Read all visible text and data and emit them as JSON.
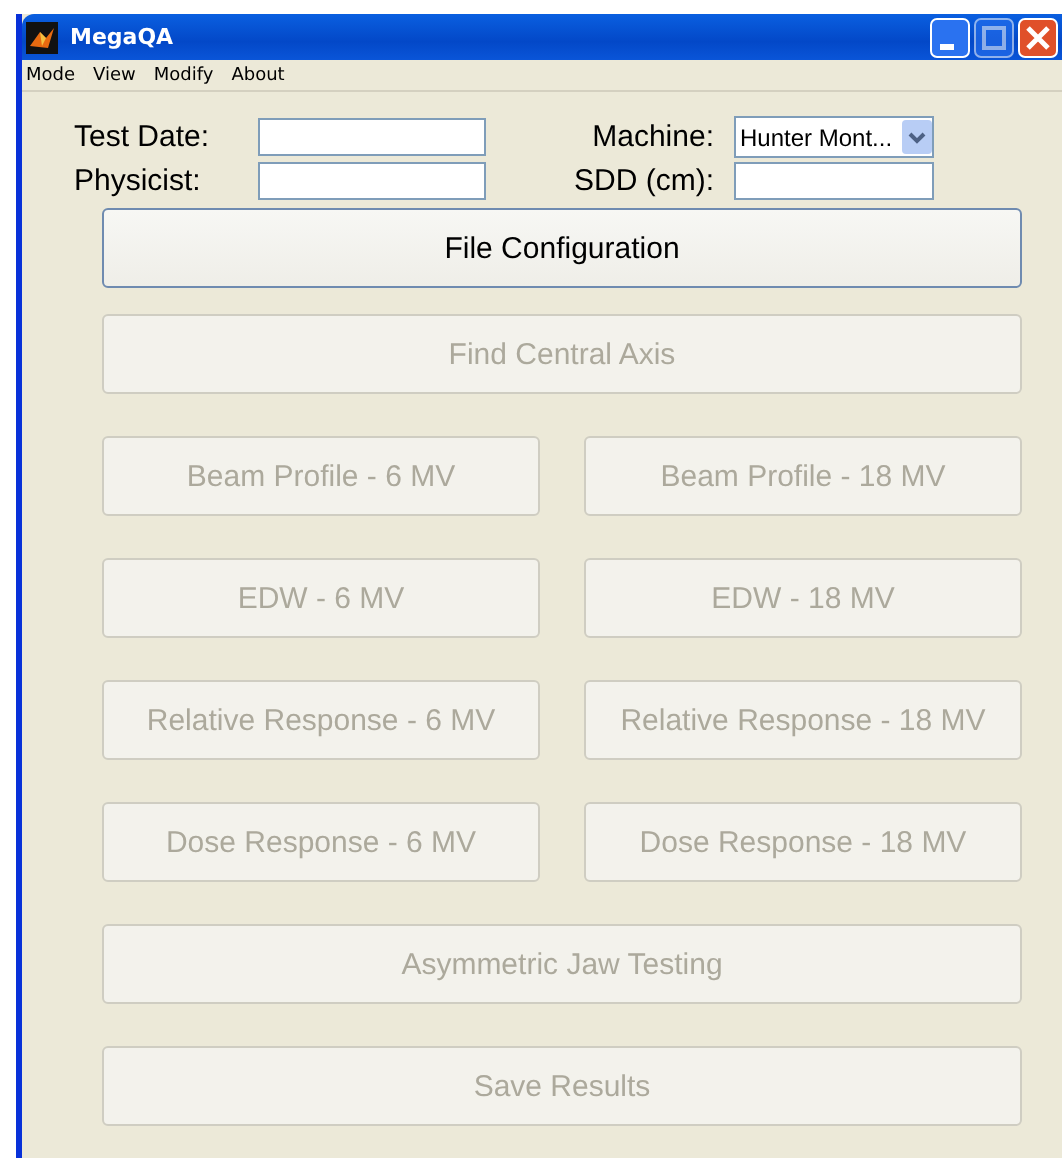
{
  "window": {
    "title": "MegaQA"
  },
  "menu": [
    "Mode",
    "View",
    "Modify",
    "About"
  ],
  "fields": [
    {
      "kind": "text",
      "label": "Test Date:"
    },
    {
      "kind": "dropdown",
      "label": "Machine:",
      "value": "Hunter Mont..."
    },
    {
      "kind": "text",
      "label": "Physicist:"
    },
    {
      "kind": "text",
      "label": "SDD (cm):"
    }
  ],
  "button_rows": [
    [
      {
        "label": "File Configuration",
        "disabled": false
      }
    ],
    [
      {
        "label": "Find Central Axis",
        "disabled": true
      }
    ],
    [
      {
        "label": "Beam Profile - 6 MV",
        "disabled": true
      },
      {
        "label": "Beam Profile - 18 MV",
        "disabled": true
      }
    ],
    [
      {
        "label": "EDW - 6 MV",
        "disabled": true
      },
      {
        "label": "EDW - 18 MV",
        "disabled": true
      }
    ],
    [
      {
        "label": "Relative Response - 6 MV",
        "disabled": true
      },
      {
        "label": "Relative Response - 18 MV",
        "disabled": true
      }
    ],
    [
      {
        "label": "Dose Response - 6 MV",
        "disabled": true
      },
      {
        "label": "Dose Response - 18 MV",
        "disabled": true
      }
    ],
    [
      {
        "label": "Asymmetric Jaw Testing",
        "disabled": true
      }
    ],
    [
      {
        "label": "Save Results",
        "disabled": true
      }
    ]
  ]
}
